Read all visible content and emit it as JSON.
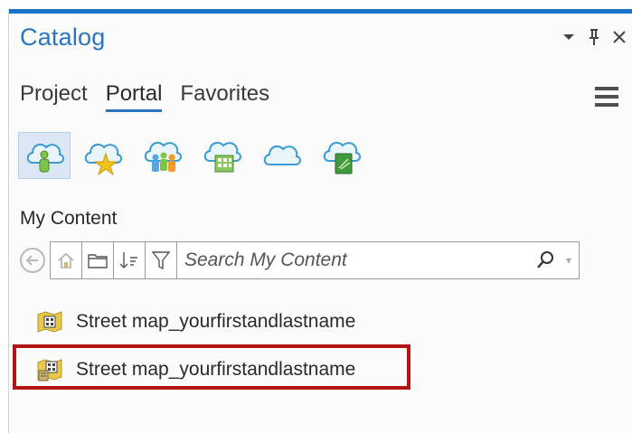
{
  "pane": {
    "title": "Catalog"
  },
  "window_controls": [
    {
      "name": "options-dropdown-icon",
      "glyph": "▾"
    },
    {
      "name": "pin-icon",
      "glyph": "⊥"
    },
    {
      "name": "close-icon",
      "glyph": "✕"
    }
  ],
  "tabs": [
    {
      "label": "Project",
      "active": false
    },
    {
      "label": "Portal",
      "active": true
    },
    {
      "label": "Favorites",
      "active": false
    }
  ],
  "portal_buttons": [
    {
      "name": "my-content-cloud-icon",
      "selected": true
    },
    {
      "name": "my-favorites-cloud-icon",
      "selected": false
    },
    {
      "name": "my-groups-cloud-icon",
      "selected": false
    },
    {
      "name": "my-organization-cloud-icon",
      "selected": false
    },
    {
      "name": "arcgis-online-cloud-icon",
      "selected": false
    },
    {
      "name": "living-atlas-cloud-icon",
      "selected": false
    }
  ],
  "section": {
    "label": "My Content"
  },
  "search": {
    "placeholder": "Search My Content"
  },
  "items": [
    {
      "label": "Street map_yourfirstandlastname",
      "icon": "map-item-icon"
    },
    {
      "label": "Street map_yourfirstandlastname",
      "icon": "map-package-item-icon",
      "highlighted": true
    }
  ],
  "colors": {
    "accent": "#1b73c9",
    "title": "#2b74c2",
    "highlight": "#b31515"
  }
}
